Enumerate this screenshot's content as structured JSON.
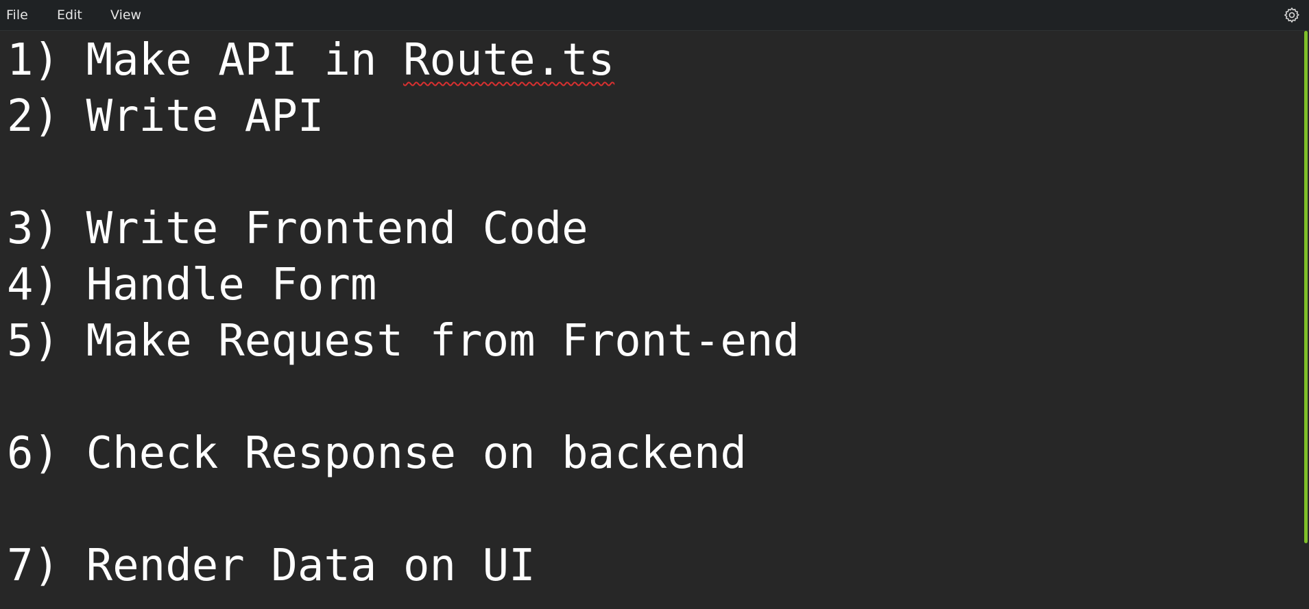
{
  "menu": {
    "file": "File",
    "edit": "Edit",
    "view": "View"
  },
  "icons": {
    "settings": "gear-icon"
  },
  "editor": {
    "lines": [
      {
        "prefix": "1) Make API in ",
        "misspelled": "Route.ts"
      },
      "2) Write API",
      "",
      "3) Write Frontend Code",
      "4) Handle Form",
      "5) Make Request from Front-end",
      "",
      "6) Check Response on backend",
      "",
      "7) Render Data on UI"
    ]
  },
  "colors": {
    "background": "#272727",
    "menubar": "#1f2224",
    "text": "#ffffff",
    "spellcheck": "#d93030",
    "scrollbar_thumb": "#7fbf2a"
  }
}
